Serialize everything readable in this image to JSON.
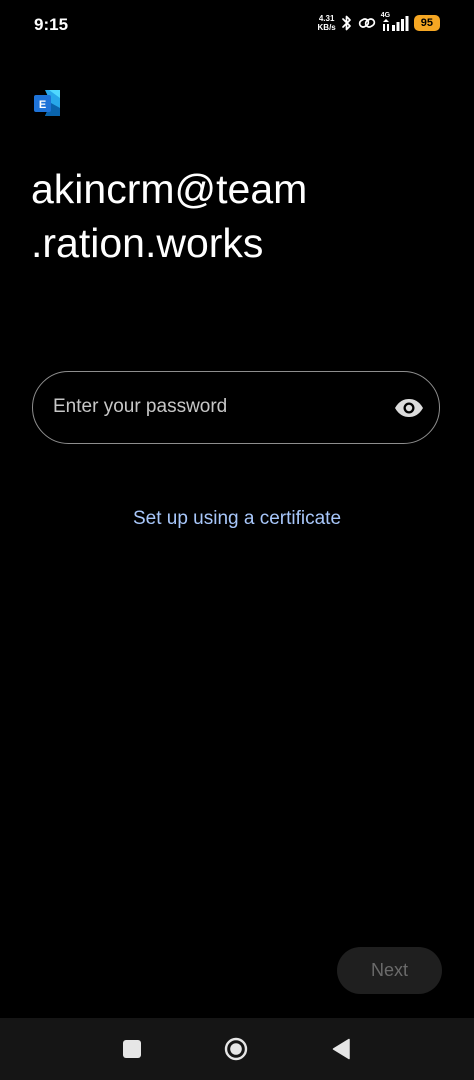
{
  "status_bar": {
    "time": "9:15",
    "net_speed_value": "4.31",
    "net_speed_unit": "KB/s",
    "network_type": "4G",
    "battery": "95",
    "icons": [
      "bluetooth-icon",
      "link-icon",
      "signal-icon",
      "battery-icon"
    ],
    "battery_color": "#f5a623"
  },
  "app": {
    "icon": "exchange-app-icon",
    "icon_letter": "E",
    "icon_color": "#1e73d8"
  },
  "account": {
    "line1": "akincrm@team",
    "line2": ".ration.works"
  },
  "password": {
    "value": "",
    "placeholder": "Enter your password",
    "toggle_icon": "eye-icon"
  },
  "certificate_link": {
    "label": "Set up using a certificate",
    "color": "#a8c7fa"
  },
  "next_button": {
    "label": "Next"
  },
  "nav_bar": {
    "recent_icon": "square-icon",
    "home_icon": "circle-icon",
    "back_icon": "triangle-back-icon"
  }
}
